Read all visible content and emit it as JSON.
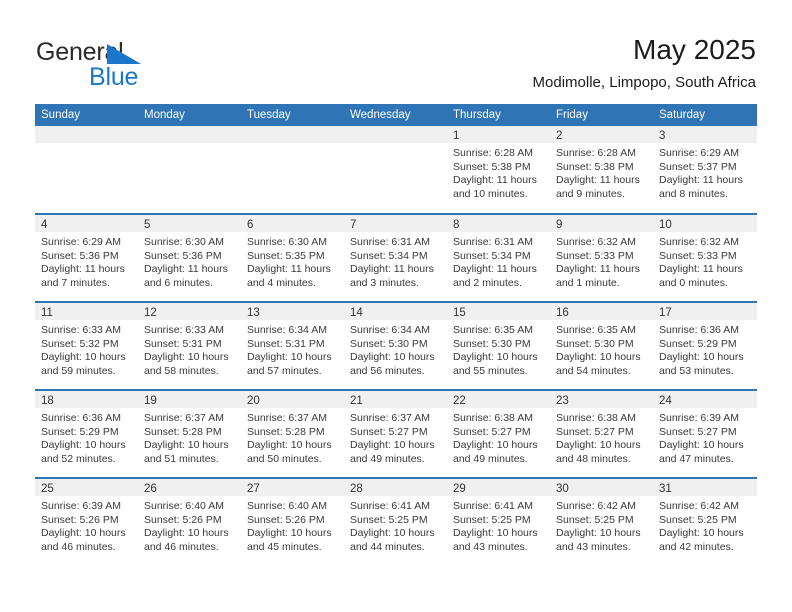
{
  "brand": {
    "name_part1": "General",
    "name_part2": "Blue",
    "flag_icon": "blue-triangle-flag-icon",
    "flag_color": "#1b77c9"
  },
  "header": {
    "title": "May 2025",
    "subtitle": "Modimolle, Limpopo, South Africa"
  },
  "colors": {
    "header_blue": "#2f74b5",
    "daynum_band": "#f0f0f0",
    "brand_blue": "#1b77c9",
    "text": "#3a3a3a"
  },
  "weekday_headers": [
    "Sunday",
    "Monday",
    "Tuesday",
    "Wednesday",
    "Thursday",
    "Friday",
    "Saturday"
  ],
  "weeks": [
    [
      {
        "day": "",
        "sunrise": "",
        "sunset": "",
        "daylight1": "",
        "daylight2": ""
      },
      {
        "day": "",
        "sunrise": "",
        "sunset": "",
        "daylight1": "",
        "daylight2": ""
      },
      {
        "day": "",
        "sunrise": "",
        "sunset": "",
        "daylight1": "",
        "daylight2": ""
      },
      {
        "day": "",
        "sunrise": "",
        "sunset": "",
        "daylight1": "",
        "daylight2": ""
      },
      {
        "day": "1",
        "sunrise": "Sunrise: 6:28 AM",
        "sunset": "Sunset: 5:38 PM",
        "daylight1": "Daylight: 11 hours",
        "daylight2": "and 10 minutes."
      },
      {
        "day": "2",
        "sunrise": "Sunrise: 6:28 AM",
        "sunset": "Sunset: 5:38 PM",
        "daylight1": "Daylight: 11 hours",
        "daylight2": "and 9 minutes."
      },
      {
        "day": "3",
        "sunrise": "Sunrise: 6:29 AM",
        "sunset": "Sunset: 5:37 PM",
        "daylight1": "Daylight: 11 hours",
        "daylight2": "and 8 minutes."
      }
    ],
    [
      {
        "day": "4",
        "sunrise": "Sunrise: 6:29 AM",
        "sunset": "Sunset: 5:36 PM",
        "daylight1": "Daylight: 11 hours",
        "daylight2": "and 7 minutes."
      },
      {
        "day": "5",
        "sunrise": "Sunrise: 6:30 AM",
        "sunset": "Sunset: 5:36 PM",
        "daylight1": "Daylight: 11 hours",
        "daylight2": "and 6 minutes."
      },
      {
        "day": "6",
        "sunrise": "Sunrise: 6:30 AM",
        "sunset": "Sunset: 5:35 PM",
        "daylight1": "Daylight: 11 hours",
        "daylight2": "and 4 minutes."
      },
      {
        "day": "7",
        "sunrise": "Sunrise: 6:31 AM",
        "sunset": "Sunset: 5:34 PM",
        "daylight1": "Daylight: 11 hours",
        "daylight2": "and 3 minutes."
      },
      {
        "day": "8",
        "sunrise": "Sunrise: 6:31 AM",
        "sunset": "Sunset: 5:34 PM",
        "daylight1": "Daylight: 11 hours",
        "daylight2": "and 2 minutes."
      },
      {
        "day": "9",
        "sunrise": "Sunrise: 6:32 AM",
        "sunset": "Sunset: 5:33 PM",
        "daylight1": "Daylight: 11 hours",
        "daylight2": "and 1 minute."
      },
      {
        "day": "10",
        "sunrise": "Sunrise: 6:32 AM",
        "sunset": "Sunset: 5:33 PM",
        "daylight1": "Daylight: 11 hours",
        "daylight2": "and 0 minutes."
      }
    ],
    [
      {
        "day": "11",
        "sunrise": "Sunrise: 6:33 AM",
        "sunset": "Sunset: 5:32 PM",
        "daylight1": "Daylight: 10 hours",
        "daylight2": "and 59 minutes."
      },
      {
        "day": "12",
        "sunrise": "Sunrise: 6:33 AM",
        "sunset": "Sunset: 5:31 PM",
        "daylight1": "Daylight: 10 hours",
        "daylight2": "and 58 minutes."
      },
      {
        "day": "13",
        "sunrise": "Sunrise: 6:34 AM",
        "sunset": "Sunset: 5:31 PM",
        "daylight1": "Daylight: 10 hours",
        "daylight2": "and 57 minutes."
      },
      {
        "day": "14",
        "sunrise": "Sunrise: 6:34 AM",
        "sunset": "Sunset: 5:30 PM",
        "daylight1": "Daylight: 10 hours",
        "daylight2": "and 56 minutes."
      },
      {
        "day": "15",
        "sunrise": "Sunrise: 6:35 AM",
        "sunset": "Sunset: 5:30 PM",
        "daylight1": "Daylight: 10 hours",
        "daylight2": "and 55 minutes."
      },
      {
        "day": "16",
        "sunrise": "Sunrise: 6:35 AM",
        "sunset": "Sunset: 5:30 PM",
        "daylight1": "Daylight: 10 hours",
        "daylight2": "and 54 minutes."
      },
      {
        "day": "17",
        "sunrise": "Sunrise: 6:36 AM",
        "sunset": "Sunset: 5:29 PM",
        "daylight1": "Daylight: 10 hours",
        "daylight2": "and 53 minutes."
      }
    ],
    [
      {
        "day": "18",
        "sunrise": "Sunrise: 6:36 AM",
        "sunset": "Sunset: 5:29 PM",
        "daylight1": "Daylight: 10 hours",
        "daylight2": "and 52 minutes."
      },
      {
        "day": "19",
        "sunrise": "Sunrise: 6:37 AM",
        "sunset": "Sunset: 5:28 PM",
        "daylight1": "Daylight: 10 hours",
        "daylight2": "and 51 minutes."
      },
      {
        "day": "20",
        "sunrise": "Sunrise: 6:37 AM",
        "sunset": "Sunset: 5:28 PM",
        "daylight1": "Daylight: 10 hours",
        "daylight2": "and 50 minutes."
      },
      {
        "day": "21",
        "sunrise": "Sunrise: 6:37 AM",
        "sunset": "Sunset: 5:27 PM",
        "daylight1": "Daylight: 10 hours",
        "daylight2": "and 49 minutes."
      },
      {
        "day": "22",
        "sunrise": "Sunrise: 6:38 AM",
        "sunset": "Sunset: 5:27 PM",
        "daylight1": "Daylight: 10 hours",
        "daylight2": "and 49 minutes."
      },
      {
        "day": "23",
        "sunrise": "Sunrise: 6:38 AM",
        "sunset": "Sunset: 5:27 PM",
        "daylight1": "Daylight: 10 hours",
        "daylight2": "and 48 minutes."
      },
      {
        "day": "24",
        "sunrise": "Sunrise: 6:39 AM",
        "sunset": "Sunset: 5:27 PM",
        "daylight1": "Daylight: 10 hours",
        "daylight2": "and 47 minutes."
      }
    ],
    [
      {
        "day": "25",
        "sunrise": "Sunrise: 6:39 AM",
        "sunset": "Sunset: 5:26 PM",
        "daylight1": "Daylight: 10 hours",
        "daylight2": "and 46 minutes."
      },
      {
        "day": "26",
        "sunrise": "Sunrise: 6:40 AM",
        "sunset": "Sunset: 5:26 PM",
        "daylight1": "Daylight: 10 hours",
        "daylight2": "and 46 minutes."
      },
      {
        "day": "27",
        "sunrise": "Sunrise: 6:40 AM",
        "sunset": "Sunset: 5:26 PM",
        "daylight1": "Daylight: 10 hours",
        "daylight2": "and 45 minutes."
      },
      {
        "day": "28",
        "sunrise": "Sunrise: 6:41 AM",
        "sunset": "Sunset: 5:25 PM",
        "daylight1": "Daylight: 10 hours",
        "daylight2": "and 44 minutes."
      },
      {
        "day": "29",
        "sunrise": "Sunrise: 6:41 AM",
        "sunset": "Sunset: 5:25 PM",
        "daylight1": "Daylight: 10 hours",
        "daylight2": "and 43 minutes."
      },
      {
        "day": "30",
        "sunrise": "Sunrise: 6:42 AM",
        "sunset": "Sunset: 5:25 PM",
        "daylight1": "Daylight: 10 hours",
        "daylight2": "and 43 minutes."
      },
      {
        "day": "31",
        "sunrise": "Sunrise: 6:42 AM",
        "sunset": "Sunset: 5:25 PM",
        "daylight1": "Daylight: 10 hours",
        "daylight2": "and 42 minutes."
      }
    ]
  ]
}
